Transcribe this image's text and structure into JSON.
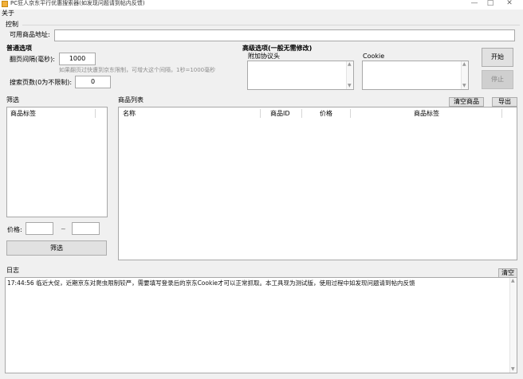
{
  "window": {
    "title": "PC狂人京东平行优惠搜索器(如发现问题请到帖内反馈)",
    "minimize": "—",
    "maximize": "□",
    "close": "✕"
  },
  "menu": {
    "about": "关于"
  },
  "control": {
    "label": "控制",
    "url_label": "可用商品地址:",
    "url_value": ""
  },
  "normal": {
    "title": "普通选项",
    "interval_label": "翻页间隔(毫秒):",
    "interval_value": "1000",
    "interval_hint": "如果翻页过快遭到京东限制，可增大这个间隔，1秒=1000毫秒",
    "pages_label": "搜索页数(0为不限制):",
    "pages_value": "0"
  },
  "advanced": {
    "title": "高级选项(一般无需修改)",
    "headers_label": "附加协议头",
    "cookie_label": "Cookie"
  },
  "actions": {
    "start": "开始",
    "stop": "停止"
  },
  "filter": {
    "label": "筛选",
    "tag_header": "商品标签",
    "price_label": "价格:",
    "price_sep": "~",
    "price_min": "",
    "price_max": "",
    "button": "筛选"
  },
  "products": {
    "label": "商品列表",
    "clear": "清空商品",
    "export": "导出",
    "columns": [
      "名称",
      "商品ID",
      "价格",
      "商品标签"
    ]
  },
  "log": {
    "label": "日志",
    "clear": "清空",
    "lines": [
      "17:44:56 临近大促，近期京东对爬虫限制较严，需要填写登录后的京东Cookie才可以正常抓取。本工具现为测试版，使用过程中如发现问题请到帖内反馈"
    ]
  }
}
